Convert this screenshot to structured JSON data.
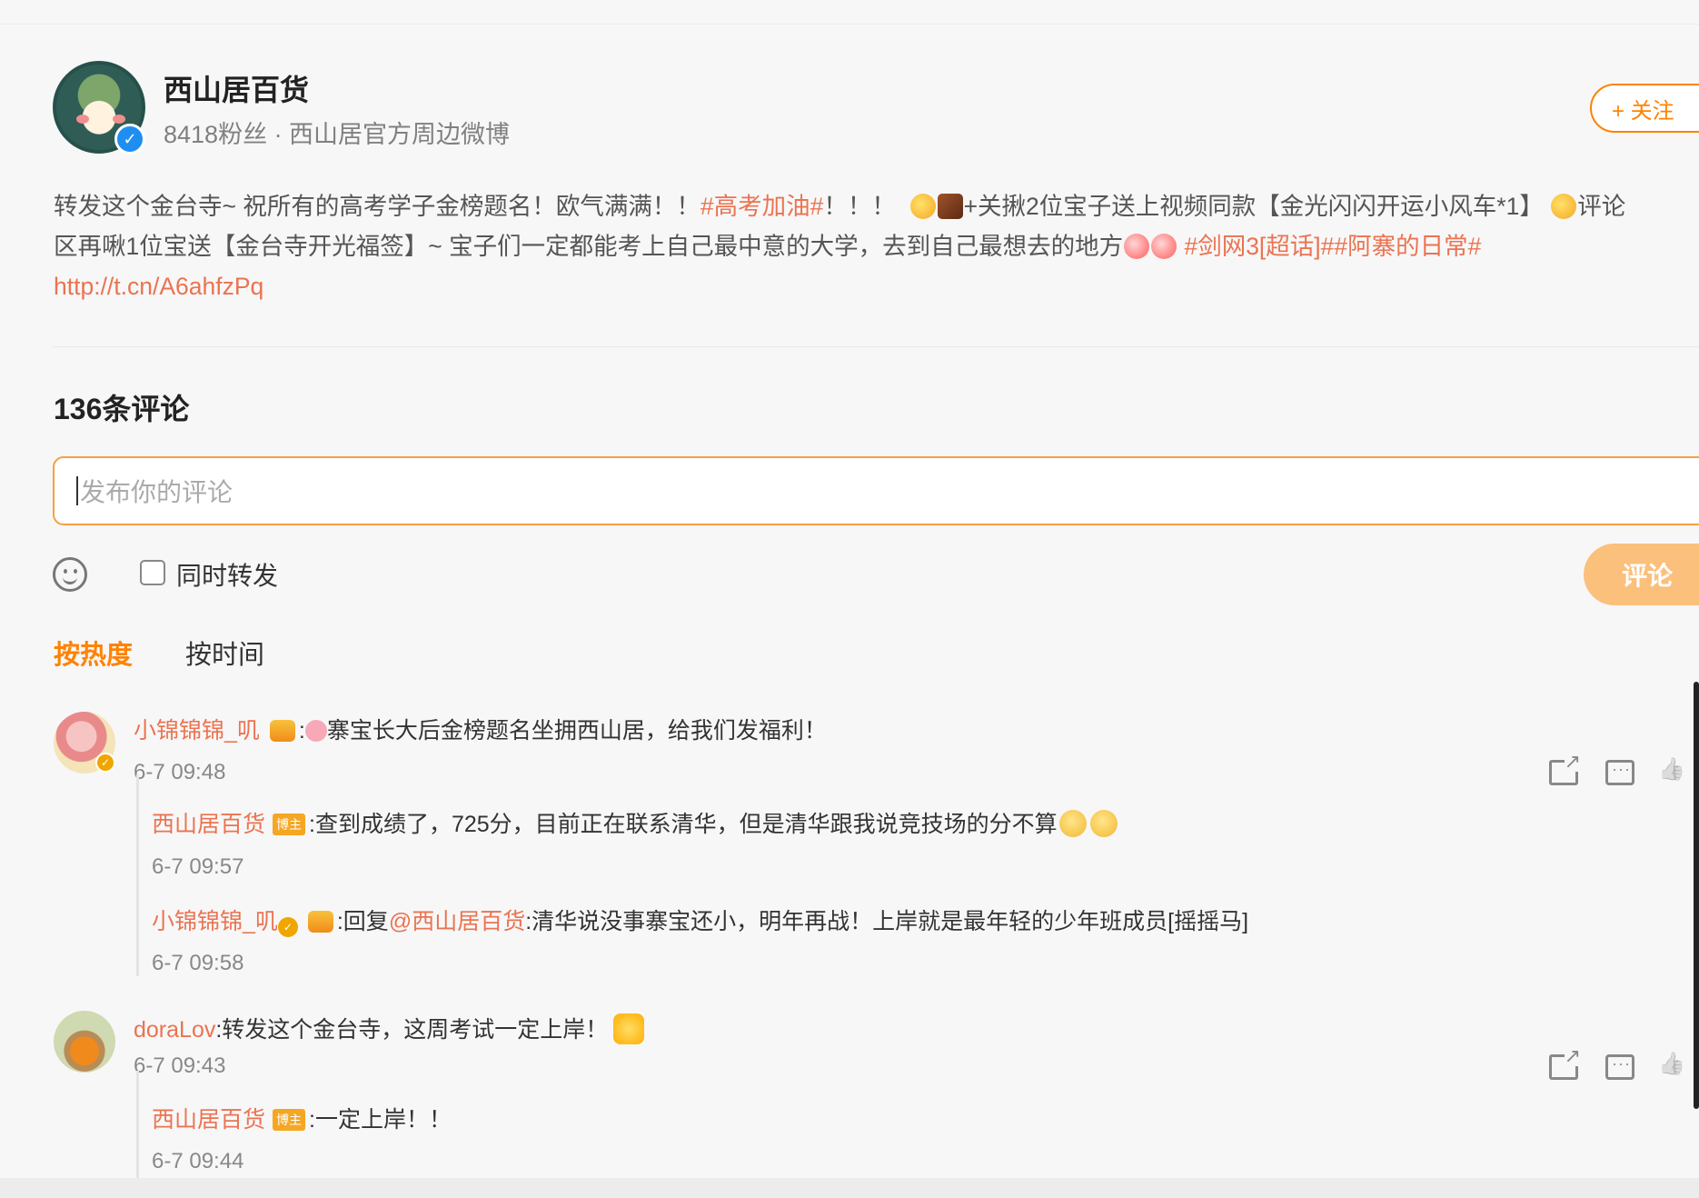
{
  "post": {
    "author": "西山居百货",
    "meta": "8418粉丝 · 西山居官方周边微博",
    "follow_label": "+ 关注",
    "text_line1_a": "转发这个金台寺~ 祝所有的高考学子金榜题名！欧气满满！！",
    "text_line1_tag": "#高考加油#",
    "text_line1_b": "！！！",
    "text_line1_c": "+关揪2位宝子送上视频同款【金光闪闪开运小风车*1】",
    "text_line1_d": "评论",
    "text_line2_a": "区再啾1位宝送【金台寺开光福签】~ 宝子们一定都能考上自己最中意的大学，去到自己最想去的地方",
    "text_line2_tags": "#剑网3[超话]##阿寨的日常#",
    "link": "http://t.cn/A6ahfzPq"
  },
  "comments_section": {
    "count_label": "136条评论",
    "input_placeholder": "发布你的评论",
    "repost_label": "同时转发",
    "submit_label": "评论",
    "sort_hot": "按热度",
    "sort_time": "按时间"
  },
  "comments": [
    {
      "user": "小锦锦锦_叽",
      "text": "寨宝长大后金榜题名坐拥西山居，给我们发福利！",
      "time": "6-7 09:48",
      "replies": [
        {
          "user": "西山居百货",
          "tag": "博主",
          "text": ":查到成绩了，725分，目前正在联系清华，但是清华跟我说竞技场的分不算",
          "time": "6-7 09:57"
        },
        {
          "user": "小锦锦锦_叽",
          "reply_prefix": ":回复",
          "mention": "@西山居百货",
          "text": ":清华说没事寨宝还小，明年再战！上岸就是最年轻的少年班成员[摇摇马]",
          "time": "6-7 09:58"
        }
      ]
    },
    {
      "user": "doraLov",
      "text": ":转发这个金台寺，这周考试一定上岸！",
      "time": "6-7 09:43",
      "replies": [
        {
          "user": "西山居百货",
          "tag": "博主",
          "text": ":一定上岸！！",
          "time": "6-7 09:44"
        }
      ]
    }
  ],
  "colors": {
    "accent": "#ff8200",
    "link": "#eb7350",
    "verified_blue": "#1f8ef1",
    "verified_gold": "#f0a600"
  },
  "icons": [
    "verified-icon",
    "smile-icon",
    "share-icon",
    "comment-icon",
    "like-icon",
    "crown-icon"
  ]
}
